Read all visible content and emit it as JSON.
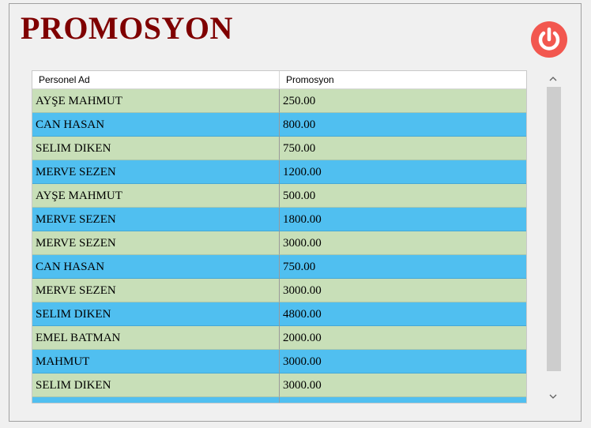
{
  "title": "PROMOSYON",
  "icons": {
    "power": "power-icon",
    "scroll_up": "chevron-up-icon",
    "scroll_down": "chevron-down-icon"
  },
  "colors": {
    "title": "#7f0000",
    "power_button": "#f2574f",
    "row_odd": "#c8dfb8",
    "row_even": "#50bff0"
  },
  "table": {
    "columns": [
      "Personel Ad",
      "Promosyon"
    ],
    "rows": [
      [
        "AYŞE MAHMUT",
        "250.00"
      ],
      [
        "CAN HASAN",
        "800.00"
      ],
      [
        "SELIM DIKEN",
        "750.00"
      ],
      [
        "MERVE SEZEN",
        "1200.00"
      ],
      [
        "AYŞE MAHMUT",
        "500.00"
      ],
      [
        "MERVE SEZEN",
        "1800.00"
      ],
      [
        "MERVE SEZEN",
        "3000.00"
      ],
      [
        "CAN HASAN",
        "750.00"
      ],
      [
        "MERVE SEZEN",
        "3000.00"
      ],
      [
        "SELIM DIKEN",
        "4800.00"
      ],
      [
        "EMEL BATMAN",
        "2000.00"
      ],
      [
        "MAHMUT",
        "3000.00"
      ],
      [
        "SELIM DIKEN",
        "3000.00"
      ],
      [
        "",
        ""
      ]
    ]
  }
}
